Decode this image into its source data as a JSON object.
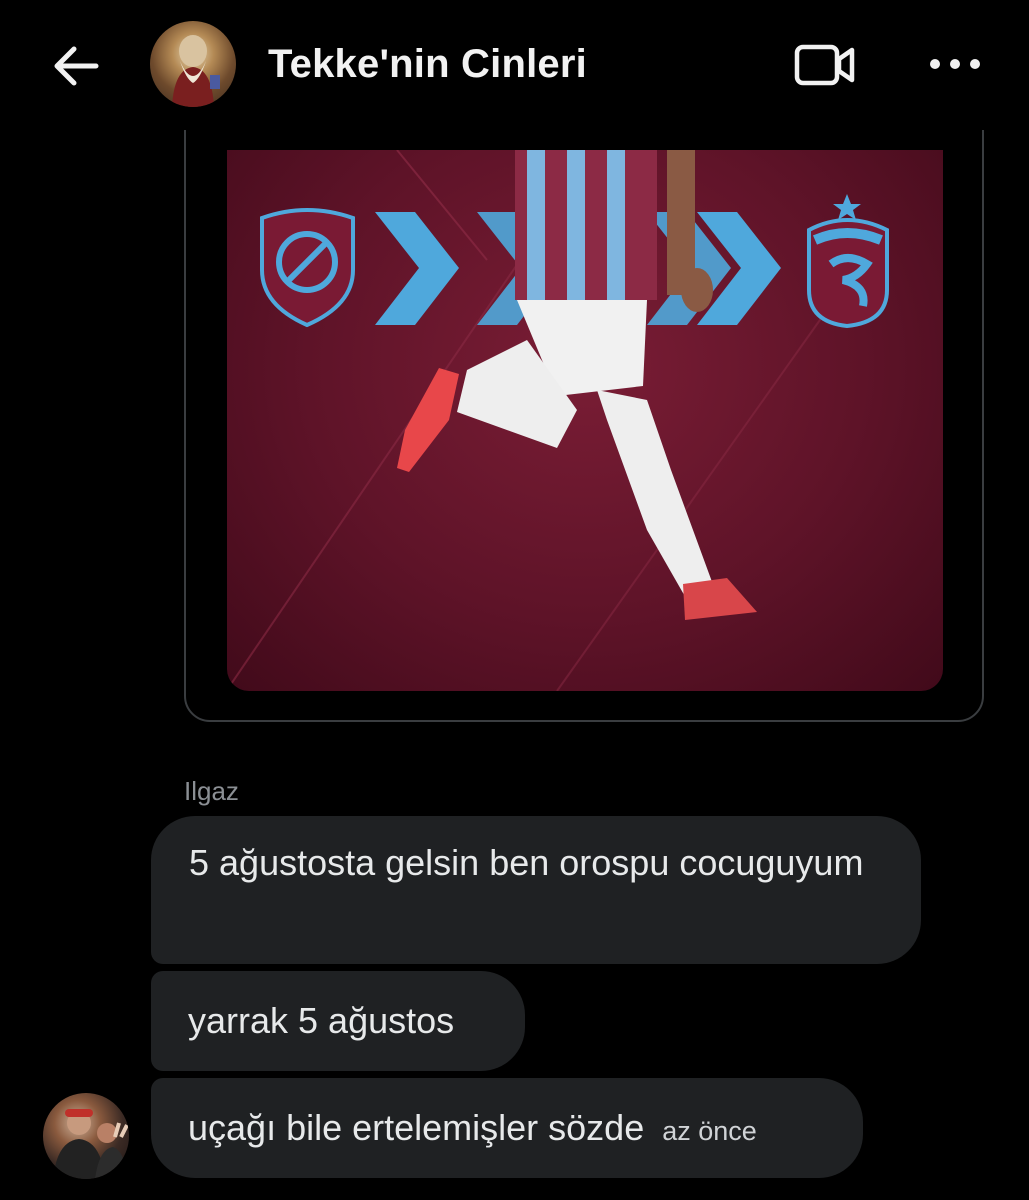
{
  "header": {
    "title": "Tekke'nin Cinleri",
    "icons": {
      "back": "arrow-left-icon",
      "video": "video-call-icon",
      "more": "more-horizontal-icon"
    }
  },
  "colors": {
    "background": "#000000",
    "bubble": "#1f2123",
    "text": "#e7e9ea",
    "muted": "#8b8f94",
    "promo_bg": "#5e1328",
    "chevron": "#4fa8dc"
  },
  "messages": [
    {
      "text": "5 ağustosta gelsin ben orospu cocuguyum"
    },
    {
      "text": "yarrak 5 ağustos"
    },
    {
      "text": "uçağı bile ertelemişler sözde",
      "time": "az önce"
    }
  ],
  "sender": {
    "name": "Ilgaz"
  }
}
